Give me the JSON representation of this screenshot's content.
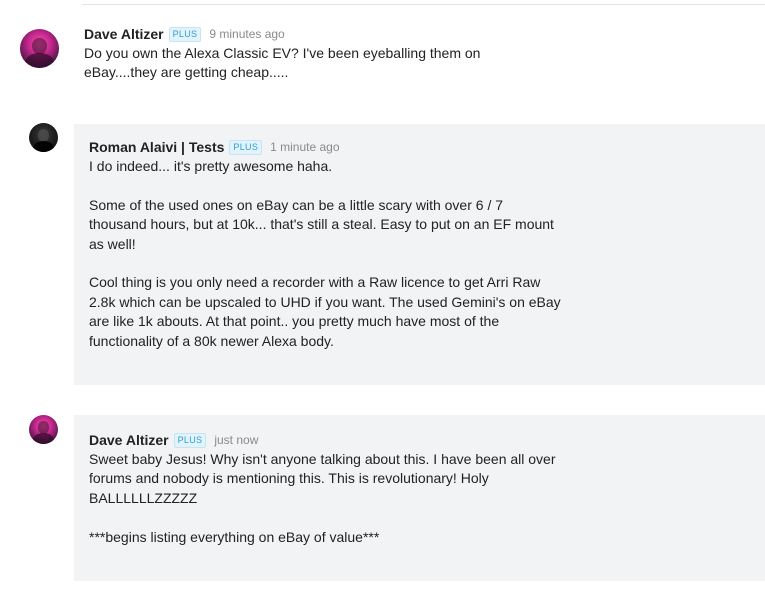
{
  "comments": [
    {
      "author": "Dave Altizer",
      "badge": "PLUS",
      "time": "9 minutes ago",
      "paragraphs": [
        "Do you own the Alexa Classic EV? I've been eyeballing them on eBay....they are getting cheap....."
      ]
    },
    {
      "author": "Roman Alaivi | Tests",
      "badge": "PLUS",
      "time": "1 minute ago",
      "paragraphs": [
        "I do indeed... it's pretty awesome haha.",
        "Some of the used ones on eBay can be a little scary with over 6 / 7 thousand hours, but at 10k... that's still a steal. Easy to put on an EF mount as well!",
        "Cool thing is you only need a recorder with a Raw licence to get Arri Raw 2.8k which can be upscaled to UHD if you want. The used Gemini's on eBay are like 1k abouts. At that point.. you pretty much have most of the functionality of a 80k newer Alexa body."
      ]
    },
    {
      "author": "Dave Altizer",
      "badge": "PLUS",
      "time": "just now",
      "paragraphs": [
        "Sweet baby Jesus! Why isn't anyone talking about this. I have been all over forums and nobody is mentioning this. This is revolutionary! Holy BALLLLLLZZZZZ",
        "***begins listing everything on eBay of value***"
      ]
    }
  ]
}
